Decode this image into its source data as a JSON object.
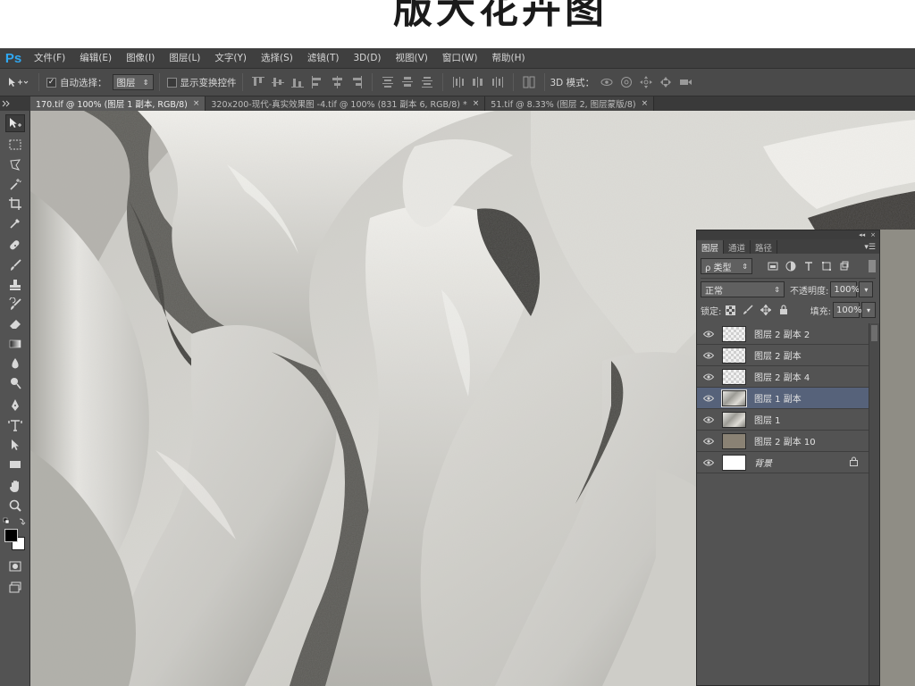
{
  "banner": {
    "text": "版大花卉图"
  },
  "app": {
    "logo": "Ps"
  },
  "menu": [
    "文件(F)",
    "编辑(E)",
    "图像(I)",
    "图层(L)",
    "文字(Y)",
    "选择(S)",
    "滤镜(T)",
    "3D(D)",
    "视图(V)",
    "窗口(W)",
    "帮助(H)"
  ],
  "options": {
    "auto_select_label": "自动选择：",
    "auto_select_checked": true,
    "auto_select_value": "图层",
    "show_transform_label": "显示变换控件",
    "show_transform_checked": false,
    "mode_3d_label": "3D 模式："
  },
  "tabs": [
    {
      "label": "170.tif @ 100% (图层 1 副本, RGB/8)",
      "close": "×",
      "active": true
    },
    {
      "label": "320x200-现代-真实效果图 -4.tif @ 100% (831 副本 6, RGB/8) *",
      "close": "×",
      "active": false
    },
    {
      "label": "51.tif @ 8.33% (图层 2, 图层蒙版/8)",
      "close": "×",
      "active": false
    }
  ],
  "layers_panel": {
    "collapse_glyph": "◂◂",
    "close_glyph": "×",
    "tabs": [
      "图层",
      "通道",
      "路径"
    ],
    "menu_glyph": "▾☰",
    "filter_label": "ρ 类型",
    "blend_mode": "正常",
    "opacity_label": "不透明度:",
    "opacity_value": "100%",
    "lock_label": "锁定:",
    "fill_label": "填充:",
    "fill_value": "100%",
    "layers": [
      {
        "name": "图层 2 副本 2",
        "thumb": "trans",
        "selected": false,
        "italic": false,
        "locked": false
      },
      {
        "name": "图层 2 副本",
        "thumb": "trans",
        "selected": false,
        "italic": false,
        "locked": false
      },
      {
        "name": "图层 2 副本 4",
        "thumb": "trans",
        "selected": false,
        "italic": false,
        "locked": false
      },
      {
        "name": "图层 1 副本",
        "thumb": "photo",
        "selected": true,
        "italic": false,
        "locked": false
      },
      {
        "name": "图层 1",
        "thumb": "photo",
        "selected": false,
        "italic": false,
        "locked": false
      },
      {
        "name": "图层 2 副本 10",
        "thumb": "tan",
        "selected": false,
        "italic": false,
        "locked": false
      },
      {
        "name": "背景",
        "thumb": "white",
        "selected": false,
        "italic": true,
        "locked": true
      }
    ]
  },
  "colors": {
    "menubar_bg": "#3f3f3f",
    "panel_bg": "#535353",
    "selected_layer": "#56627a",
    "logo": "#2fa8f2",
    "foreground_swatch": "#000000",
    "background_swatch": "#ffffff"
  },
  "tool_icons": [
    "move-icon",
    "marquee-icon",
    "lasso-icon",
    "magic-wand-icon",
    "crop-icon",
    "eyedropper-icon",
    "healing-brush-icon",
    "brush-icon",
    "clone-stamp-icon",
    "history-brush-icon",
    "eraser-icon",
    "gradient-icon",
    "blur-icon",
    "dodge-icon",
    "pen-icon",
    "type-icon",
    "path-selection-icon",
    "rectangle-icon",
    "hand-icon",
    "zoom-icon"
  ]
}
